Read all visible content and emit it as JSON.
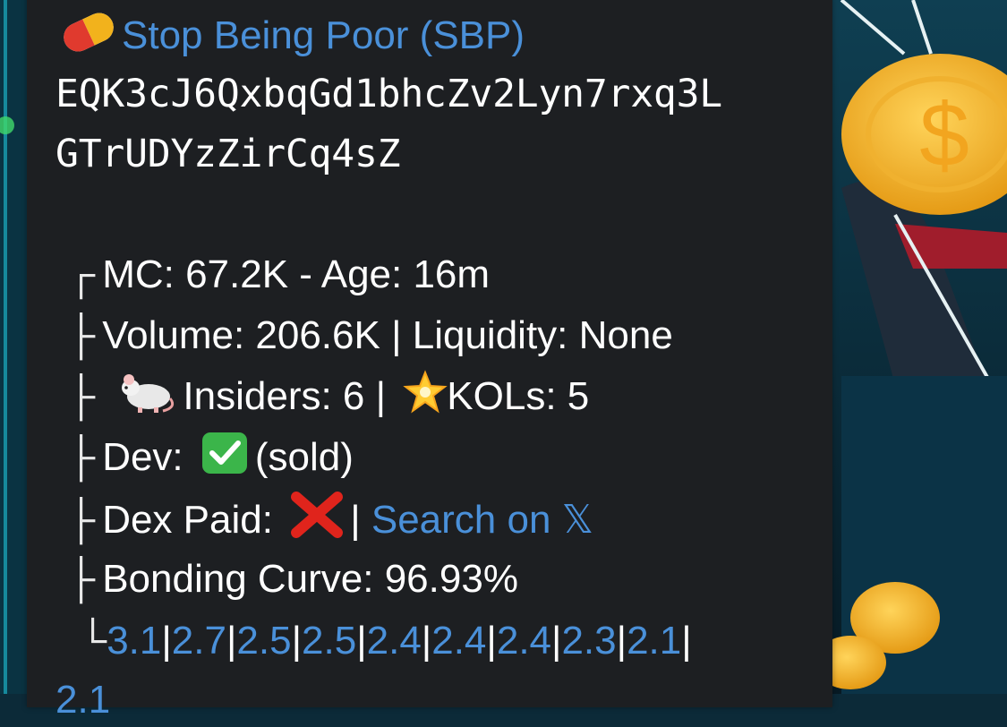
{
  "token": {
    "icon": "pill-icon",
    "name": "Stop Being Poor (SBP)",
    "address_line1": "EQK3cJ6QxbqGd1bhcZv2Lyn7rxq3L",
    "address_line2": "GTrUDYzZirCq4sZ"
  },
  "stats": {
    "tree": {
      "first": "┌",
      "mid": "├",
      "last": "└"
    },
    "mc_age": "MC: 67.2K - Age: 16m",
    "volume_liquidity": "Volume: 206.6K | Liquidity: None",
    "insiders_label": "Insiders: 6 |",
    "insiders_icon": "rat-icon",
    "kols_label": "KOLs: 5",
    "kols_icon": "star-icon",
    "dev_label": "Dev:",
    "dev_icon": "check-icon",
    "dev_status": "(sold)",
    "dex_label": "Dex Paid:",
    "dex_icon": "cross-icon",
    "separator": "|",
    "search_link": "Search on 𝕏",
    "bonding_curve": "Bonding Curve: 96.93%",
    "holders": [
      "3.1",
      "2.7",
      "2.5",
      "2.5",
      "2.4",
      "2.4",
      "2.4",
      "2.3",
      "2.1"
    ],
    "holders_sep": "|",
    "holders_next": "2.1"
  },
  "colors": {
    "bubble": "#1d1f22",
    "link": "#4a90d9",
    "text": "#ffffff"
  }
}
